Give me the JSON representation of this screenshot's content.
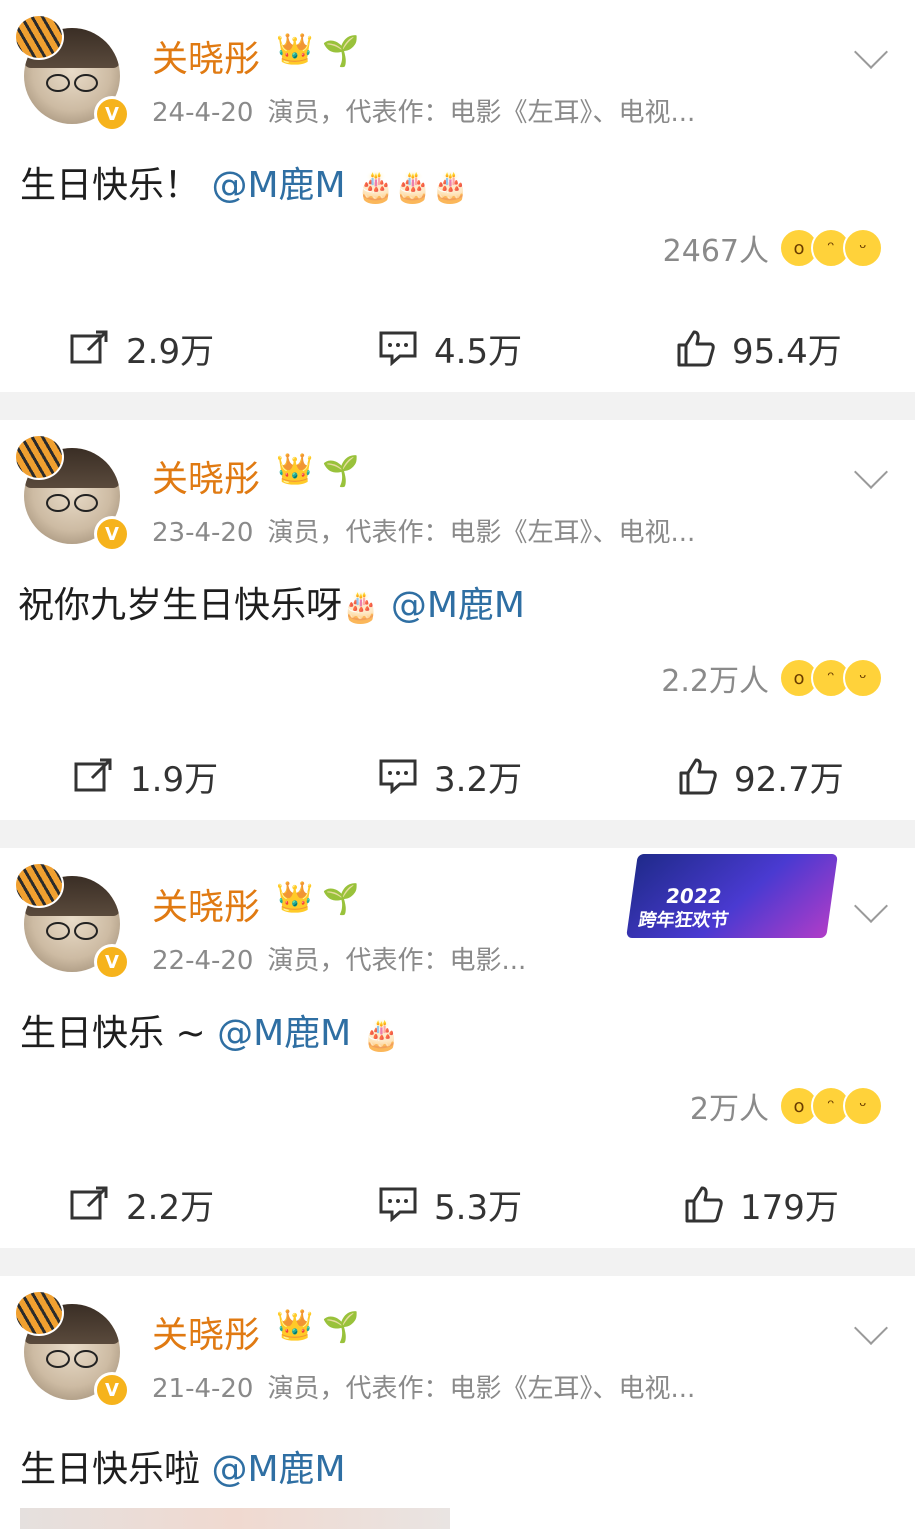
{
  "posts": [
    {
      "user": "关晓彤",
      "date": "24-4-20",
      "desc": "演员，代表作：电影《左耳》、电视...",
      "text": "生日快乐！",
      "mention": "@M鹿M",
      "cakes": "🎂🎂🎂",
      "reactions": "2467人",
      "reposts": "2.9万",
      "comments": "4.5万",
      "likes": "95.4万"
    },
    {
      "user": "关晓彤",
      "date": "23-4-20",
      "desc": "演员，代表作：电影《左耳》、电视...",
      "text": "祝你九岁生日快乐呀",
      "mention": "@M鹿M",
      "cakes": "🎂",
      "reactions": "2.2万人",
      "reposts": "1.9万",
      "comments": "3.2万",
      "likes": "92.7万"
    },
    {
      "user": "关晓彤",
      "date": "22-4-20",
      "desc": "演员，代表作：电影...",
      "text": "生日快乐 ~",
      "mention": "@M鹿M",
      "cakes": "🎂",
      "reactions": "2万人",
      "reposts": "2.2万",
      "comments": "5.3万",
      "likes": "179万",
      "banner_year": "2022",
      "banner_text": "跨年狂欢节"
    },
    {
      "user": "关晓彤",
      "date": "21-4-20",
      "desc": "演员，代表作：电影《左耳》、电视...",
      "text": "生日快乐啦",
      "mention": "@M鹿M"
    }
  ],
  "icons": {
    "crown": "crown-badge-icon",
    "sprout": "sprout-badge-icon",
    "verify": "verified-v-icon",
    "repost": "repost-icon",
    "comment": "comment-icon",
    "like": "thumbs-up-icon"
  },
  "colors": {
    "username": "#e07a12",
    "mention": "#2f6fa3",
    "meta": "#8a8a8a",
    "verify": "#f6b31c",
    "separator": "#f2f2f2"
  }
}
